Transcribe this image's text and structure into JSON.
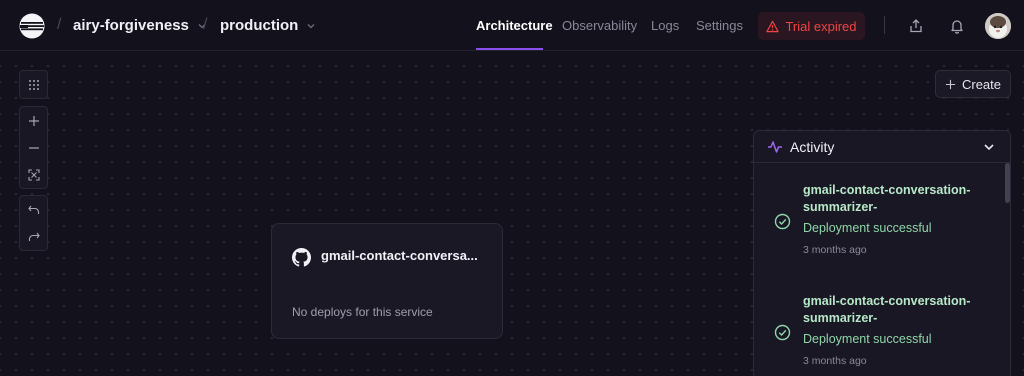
{
  "header": {
    "project": "airy-forgiveness",
    "environment": "production",
    "separator": "/",
    "tabs": [
      {
        "label": "Architecture",
        "active": true
      },
      {
        "label": "Observability",
        "active": false
      },
      {
        "label": "Logs",
        "active": false
      },
      {
        "label": "Settings",
        "active": false
      }
    ],
    "trial_label": "Trial expired",
    "icons": {
      "logo": "railway-logo-icon",
      "share": "share-icon",
      "bell": "bell-icon",
      "avatar": "user-avatar"
    }
  },
  "toolbar": {
    "icons": [
      "grid-icon",
      "zoom-in-icon",
      "zoom-out-icon",
      "fit-view-icon",
      "undo-icon",
      "redo-icon"
    ]
  },
  "create_button": {
    "label": "Create"
  },
  "activity": {
    "title": "Activity",
    "items": [
      {
        "title": "gmail-contact-conversation-summarizer-",
        "status": "Deployment successful",
        "time": "3 months ago"
      },
      {
        "title": "gmail-contact-conversation-summarizer-",
        "status": "Deployment successful",
        "time": "3 months ago"
      }
    ]
  },
  "service": {
    "name": "gmail-contact-conversa...",
    "message": "No deploys for this service"
  },
  "colors": {
    "accent": "#8a4fe8",
    "danger": "#ef4444",
    "success": "#8fd6a8",
    "background": "#13111c"
  }
}
